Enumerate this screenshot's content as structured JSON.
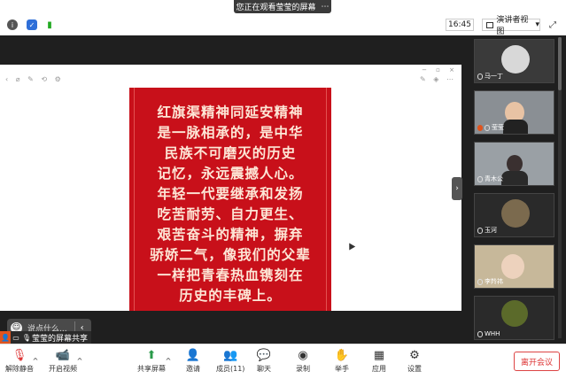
{
  "banner": {
    "text": "您正在观看莹莹的屏幕",
    "more": "⋯"
  },
  "topbar": {
    "time": "16:45",
    "view_label": "演讲者视图",
    "view_caret": "▾"
  },
  "document": {
    "poster_lines": [
      "红旗渠精神同延安精神",
      "是一脉相承的，是中华",
      "民族不可磨灭的历史",
      "记忆，永远震撼人心。",
      "年轻一代要继承和发扬",
      "吃苦耐劳、自力更生、",
      "艰苦奋斗的精神，摒弃",
      "骄娇二气，像我们的父辈",
      "一样把青春热血镌刻在",
      "历史的丰碑上。"
    ],
    "poster_color": "#c8101a"
  },
  "chat": {
    "placeholder": "说点什么..."
  },
  "self_share": {
    "label": "莹莹的屏幕共享"
  },
  "participants": [
    {
      "name": "马一丁"
    },
    {
      "name": "莹莹"
    },
    {
      "name": "青木公"
    },
    {
      "name": "玉河"
    },
    {
      "name": "李羚祎"
    },
    {
      "name": "WHH"
    }
  ],
  "toolbar": {
    "mute": "解除静音",
    "video": "开启视频",
    "share": "共享屏幕",
    "invite": "邀请",
    "members": "成员(11)",
    "chat": "聊天",
    "record": "录制",
    "raise_hand": "举手",
    "apps": "应用",
    "settings": "设置",
    "leave": "离开会议"
  },
  "colors": {
    "accent": "#e0541e",
    "leave": "#dd3333",
    "stage": "#1f1f1f"
  }
}
